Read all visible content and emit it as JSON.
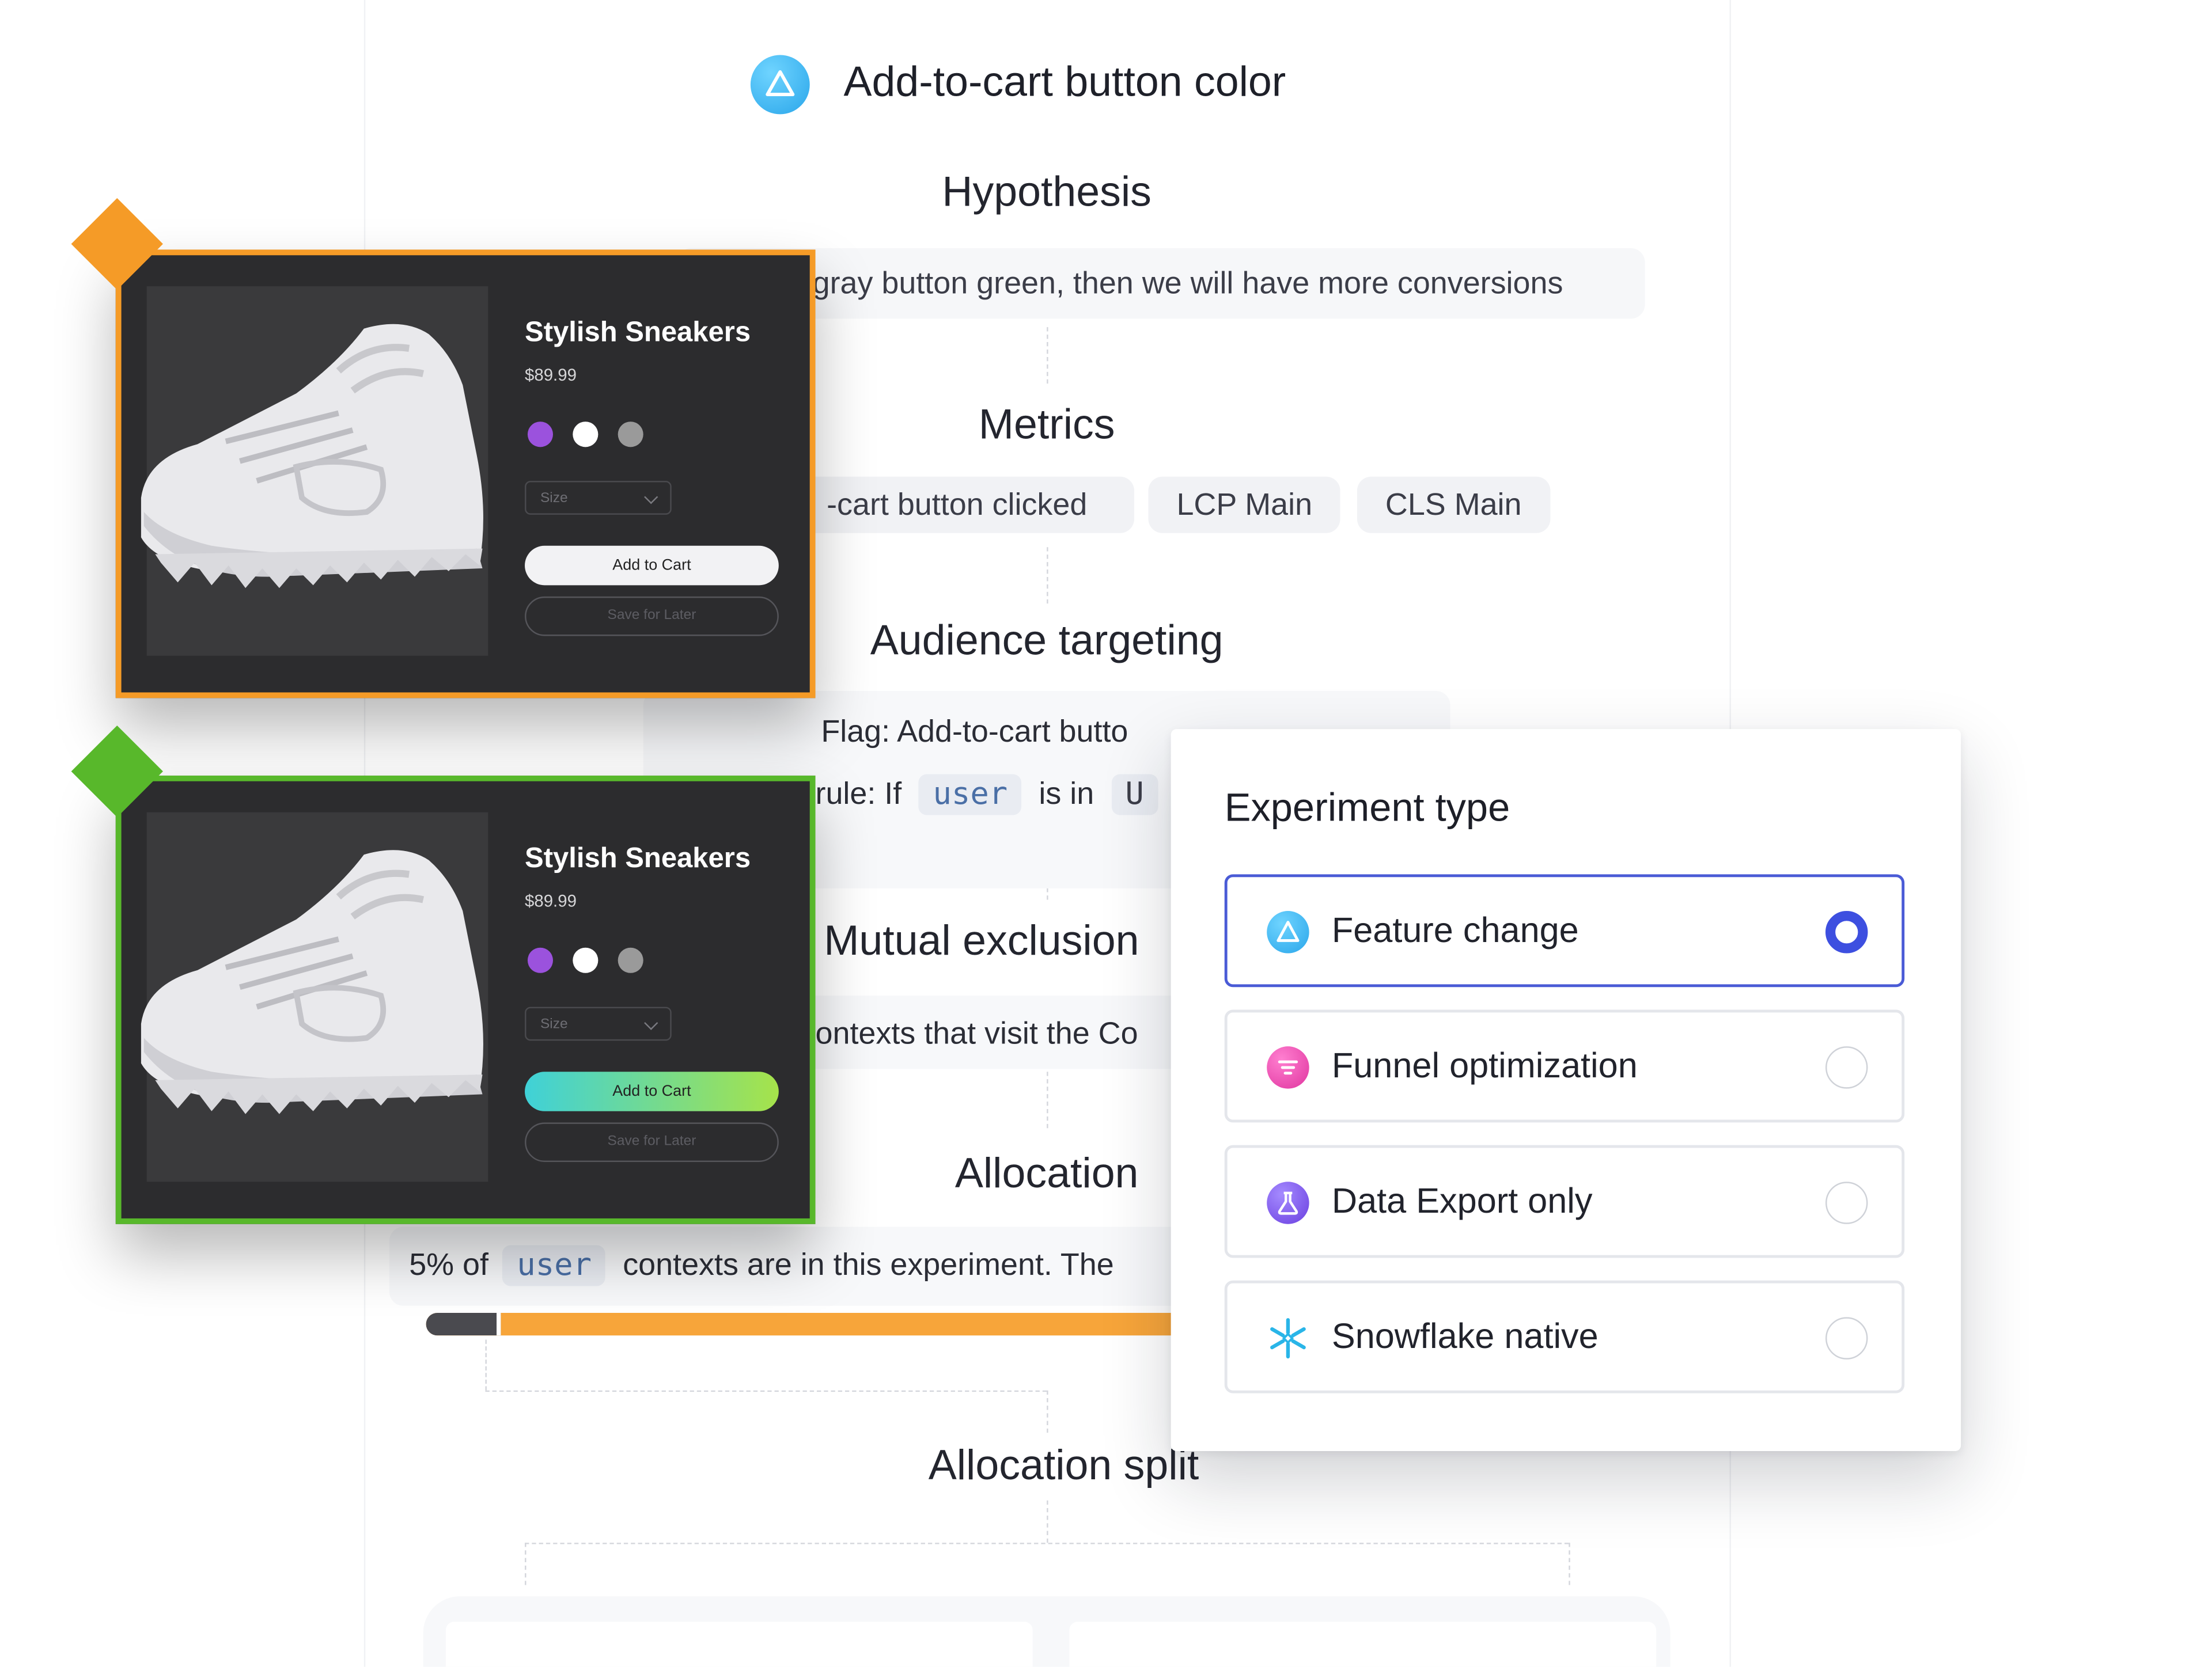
{
  "header": {
    "title": "Add-to-cart button color"
  },
  "sections": {
    "hypothesis_title": "Hypothesis",
    "hypothesis_text": "gray button green, then we will have more conversions",
    "metrics_title": "Metrics",
    "metrics": [
      "-cart button clicked",
      "LCP Main",
      "CLS Main"
    ],
    "audience_title": "Audience targeting",
    "audience_flag": "Flag: Add-to-cart butto",
    "audience_rule_prefix": "rule:  If",
    "audience_rule_code": "user",
    "audience_rule_mid": "is in",
    "audience_rule_tail": "U",
    "mutual_title": "Mutual exclusion",
    "mutual_text": "ontexts that visit the Co",
    "allocation_title": "Allocation",
    "allocation_prefix": "5% of",
    "allocation_code": "user",
    "allocation_suffix": "contexts are in this experiment.  The",
    "allocation_progress": 0.05,
    "split_title": "Allocation split"
  },
  "cards": [
    {
      "variant": "control",
      "accent": "#f59b27",
      "name": "Stylish Sneakers",
      "price": "$89.99",
      "size_label": "Size",
      "cart_label": "Add to Cart",
      "save_label": "Save for Later"
    },
    {
      "variant": "treatment",
      "accent": "#58b82b",
      "name": "Stylish Sneakers",
      "price": "$89.99",
      "size_label": "Size",
      "cart_label": "Add to Cart",
      "save_label": "Save for Later"
    }
  ],
  "swatch_colors": [
    "#9b52dd",
    "#ffffff",
    "#9a9a9a"
  ],
  "experiment_panel": {
    "title": "Experiment type",
    "options": [
      {
        "label": "Feature change",
        "icon": "triangle-icon",
        "selected": true
      },
      {
        "label": "Funnel optimization",
        "icon": "funnel-icon",
        "selected": false
      },
      {
        "label": "Data Export only",
        "icon": "flask-icon",
        "selected": false
      },
      {
        "label": "Snowflake native",
        "icon": "snowflake-icon",
        "selected": false
      }
    ]
  },
  "colors": {
    "selected_border": "#4a5bd6",
    "radio_selected": "#3d4fe0",
    "allocation_bar": "#f7a53a"
  }
}
